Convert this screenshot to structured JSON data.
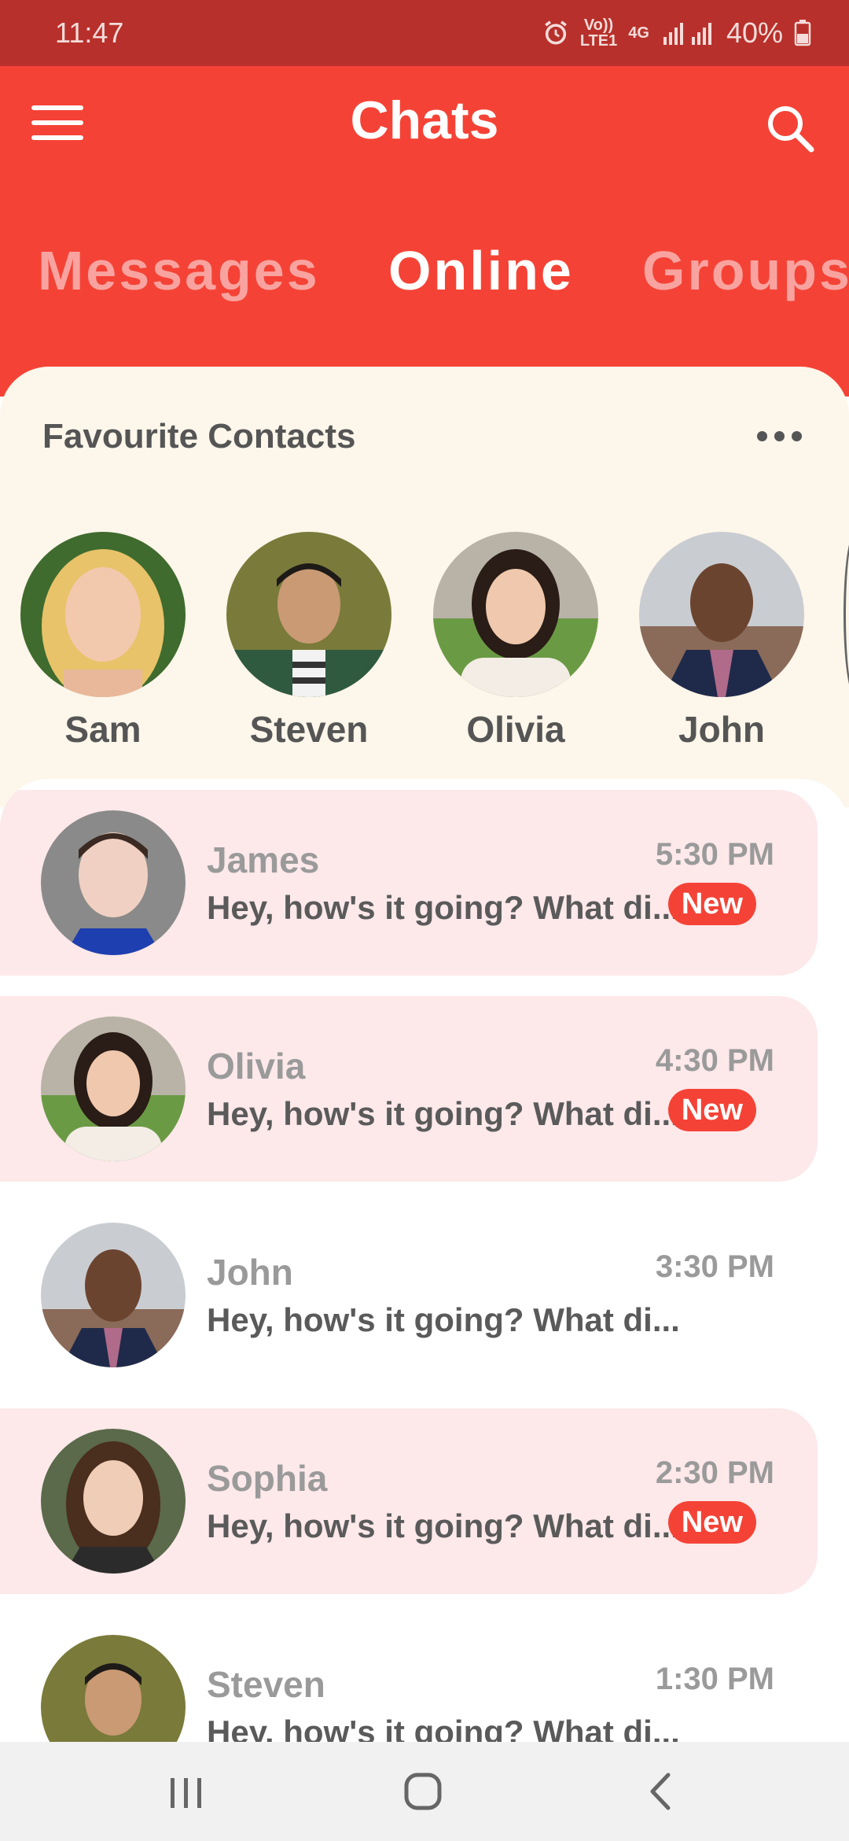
{
  "status_bar": {
    "time": "11:47",
    "network_top": "Vo))",
    "network_bottom": "LTE1",
    "network_type": "4G",
    "battery": "40%"
  },
  "header": {
    "title": "Chats",
    "tabs": [
      {
        "label": "Messages",
        "active": false
      },
      {
        "label": "Online",
        "active": true
      },
      {
        "label": "Groups",
        "active": false
      }
    ]
  },
  "favourites": {
    "title": "Favourite Contacts",
    "contacts": [
      {
        "name": "Sam"
      },
      {
        "name": "Steven"
      },
      {
        "name": "Olivia"
      },
      {
        "name": "John"
      }
    ]
  },
  "chats": [
    {
      "name": "James",
      "message": "Hey, how's it going? What di...",
      "time": "5:30 PM",
      "unread": true,
      "badge": "New"
    },
    {
      "name": "Olivia",
      "message": "Hey, how's it going? What di...",
      "time": "4:30 PM",
      "unread": true,
      "badge": "New"
    },
    {
      "name": "John",
      "message": "Hey, how's it going? What di...",
      "time": "3:30 PM",
      "unread": false
    },
    {
      "name": "Sophia",
      "message": "Hey, how's it going? What di...",
      "time": "2:30 PM",
      "unread": true,
      "badge": "New"
    },
    {
      "name": "Steven",
      "message": "Hey, how's it going? What di...",
      "time": "1:30 PM",
      "unread": false
    }
  ],
  "colors": {
    "accent": "#f44336",
    "status_bar": "#b8302b",
    "panel": "#fdf6ea",
    "unread_row": "#fde8ea"
  },
  "icons": [
    "menu-icon",
    "search-icon",
    "more-icon",
    "recents-icon",
    "home-icon",
    "back-icon"
  ]
}
